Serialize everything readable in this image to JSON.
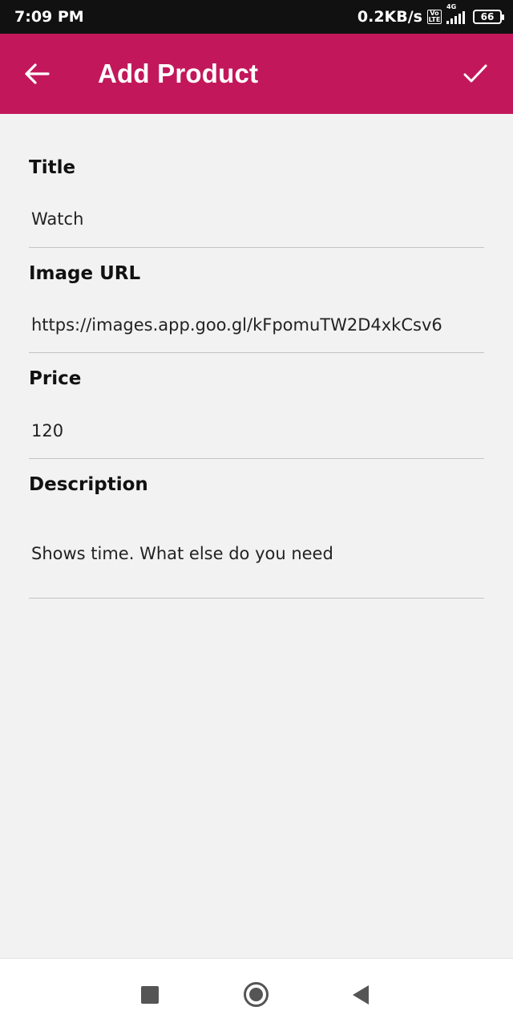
{
  "status_bar": {
    "time": "7:09 PM",
    "speed": "0.2KB/s",
    "volte_top": "Vo",
    "volte_bottom": "LTE",
    "network": "4G",
    "battery": "66"
  },
  "app_bar": {
    "title": "Add Product",
    "back_icon": "arrow-left-icon",
    "save_icon": "check-icon",
    "color": "#c2185b"
  },
  "form": {
    "title_label": "Title",
    "title_value": "Watch",
    "image_label": "Image URL",
    "image_value": "https://images.app.goo.gl/kFpomuTW2D4xkCsv6",
    "price_label": "Price",
    "price_value": "120",
    "description_label": "Description",
    "description_value": "Shows time. What else do you need"
  },
  "nav_bar": {
    "recents_icon": "square-icon",
    "home_icon": "circle-icon",
    "back_icon": "triangle-back-icon"
  }
}
